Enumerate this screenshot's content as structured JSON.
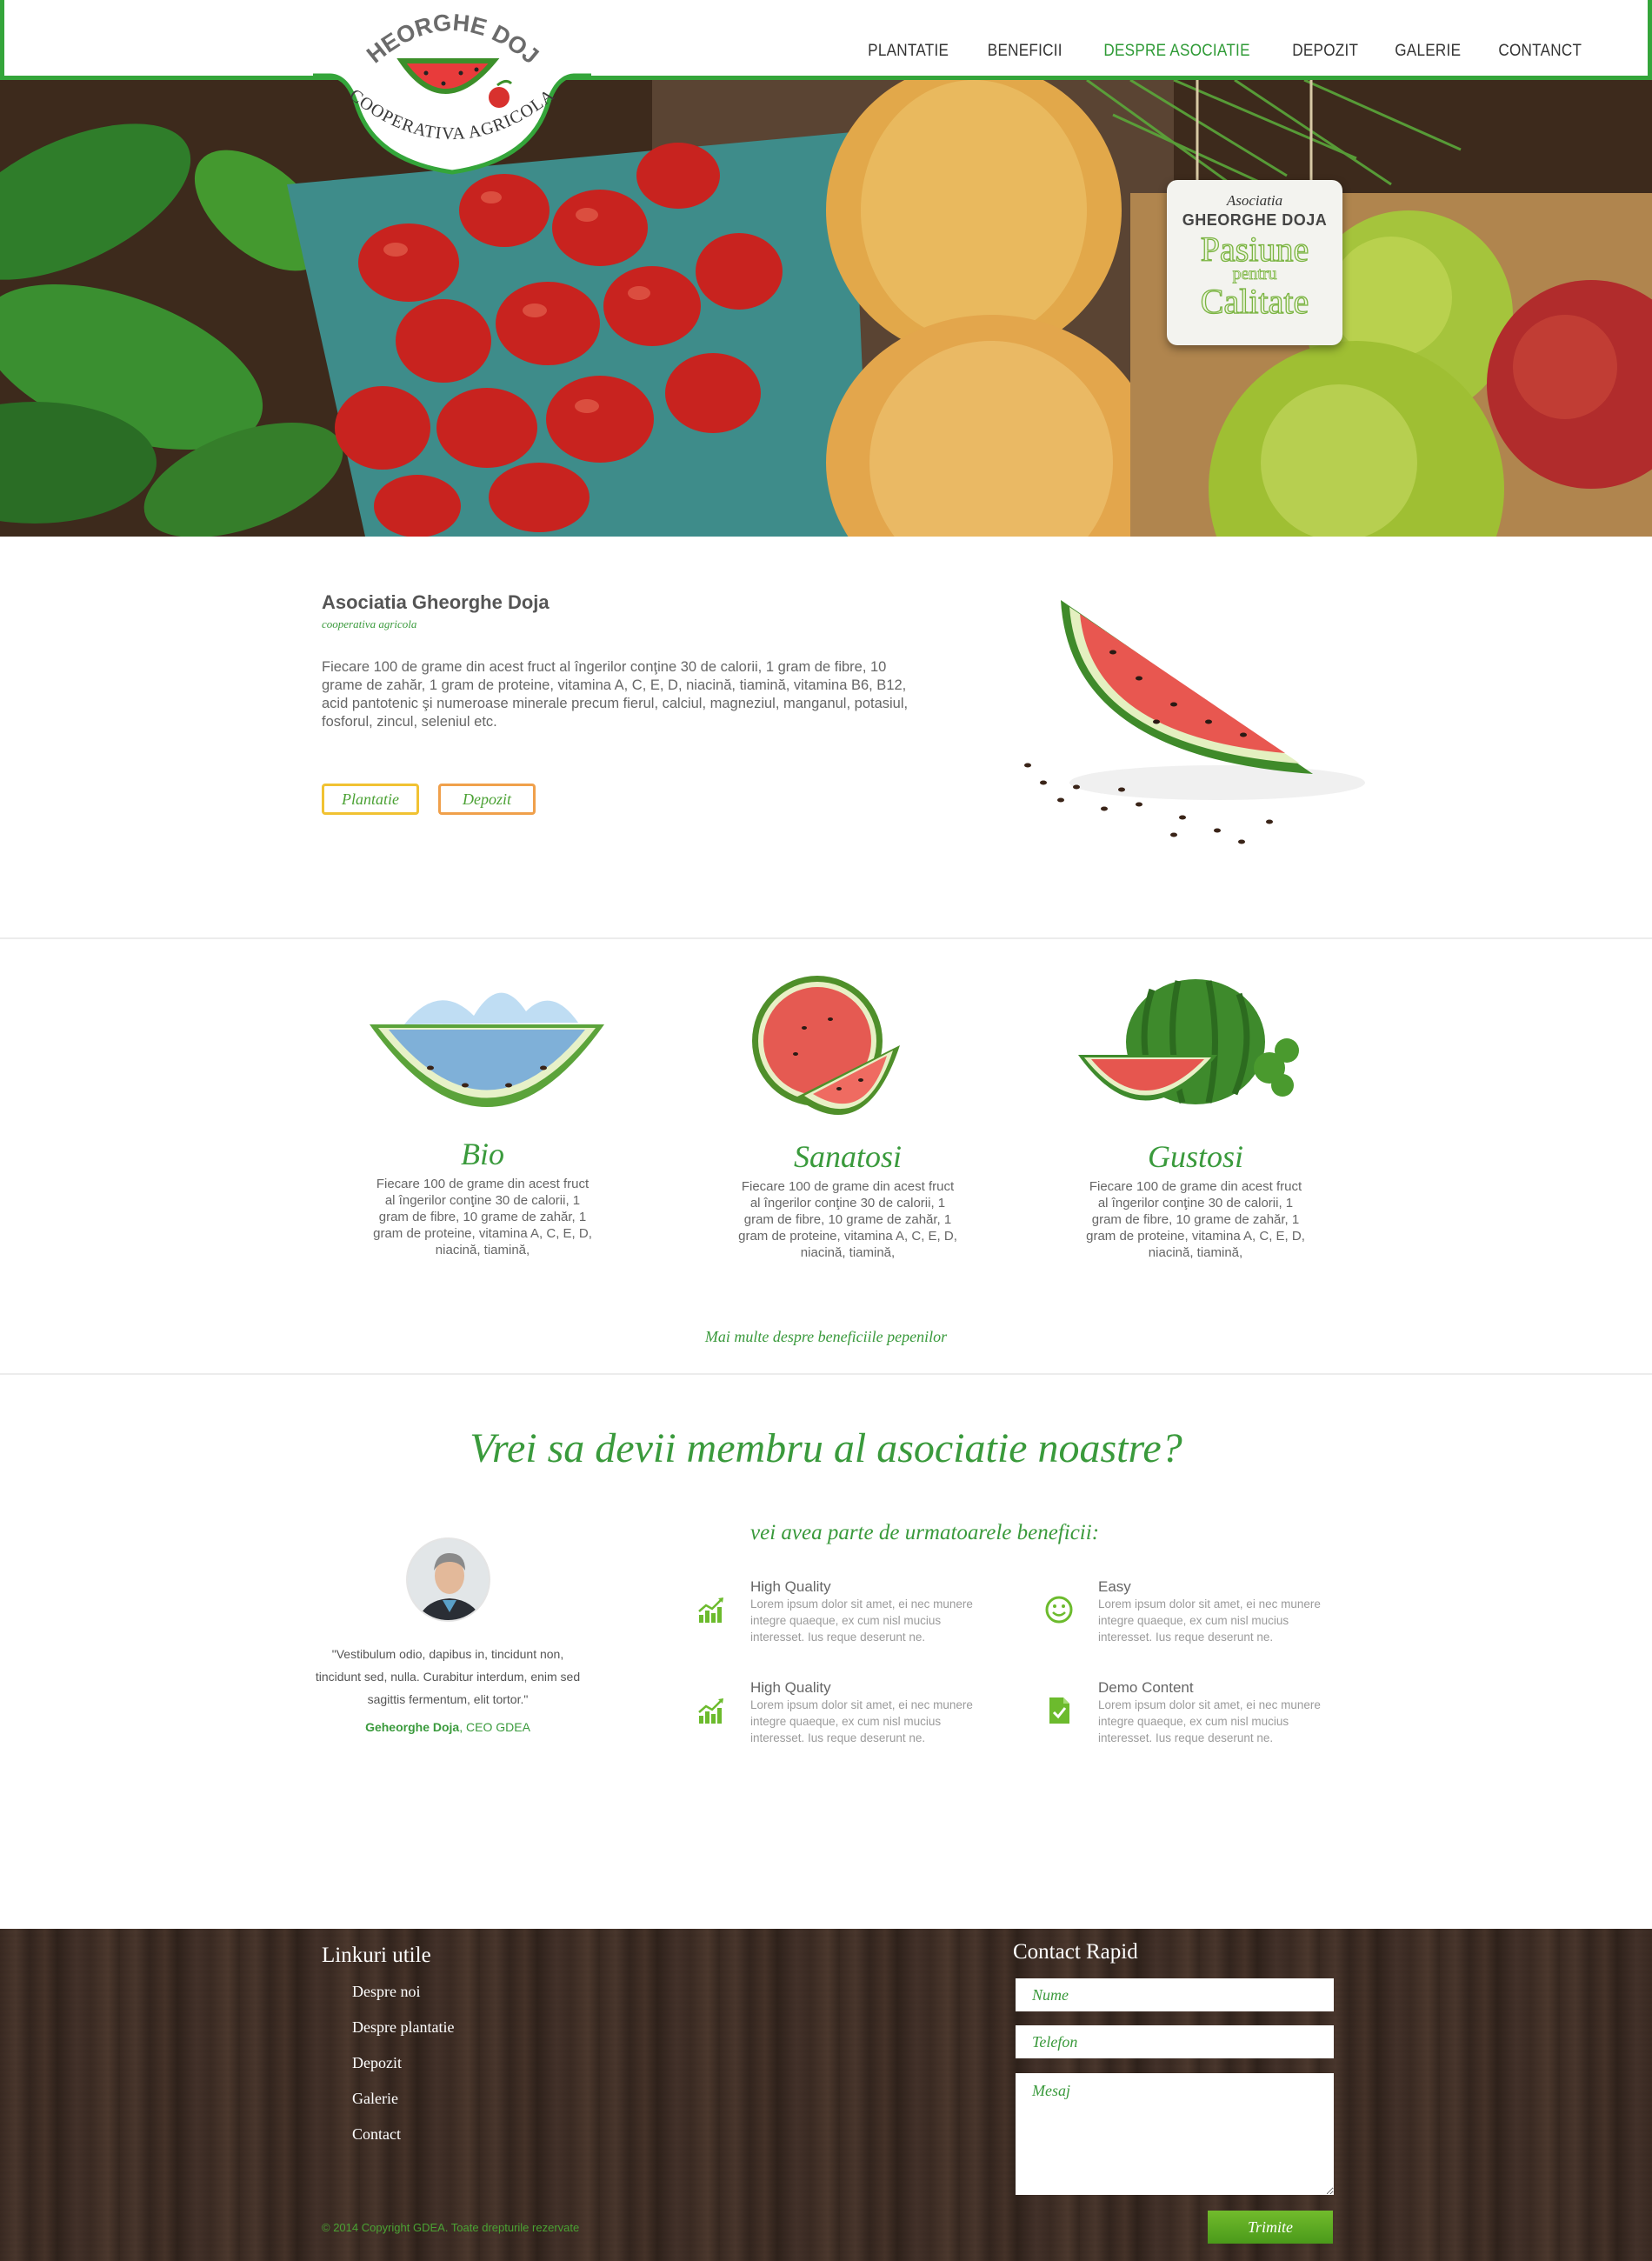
{
  "brand": {
    "logo_top": "GHEORGHE DOJA",
    "logo_bottom": "COOPERATIVA AGRICOLA"
  },
  "nav": {
    "items": [
      {
        "label": "PLANTATIE",
        "active": false
      },
      {
        "label": "BENEFICII",
        "active": false
      },
      {
        "label": "DESPRE ASOCIATIE",
        "active": true
      },
      {
        "label": "DEPOZIT",
        "active": false
      },
      {
        "label": "GALERIE",
        "active": false
      },
      {
        "label": "CONTANCT",
        "active": false
      }
    ]
  },
  "hero": {
    "tag_line1": "Asociatia",
    "tag_line2": "GHEORGHE DOJA",
    "tag_line3": "Pasiune",
    "tag_line4": "pentru",
    "tag_line5": "Calitate"
  },
  "intro": {
    "title": "Asociatia Gheorghe Doja",
    "subtitle": "cooperativa agricola",
    "text": "Fiecare 100 de grame din acest fruct al îngerilor conţine 30 de calorii, 1 gram de fibre, 10 grame de zahăr, 1 gram de proteine, vitamina A, C, E, D, niacină, tiamină, vitamina B6, B12, acid pantotenic şi numeroase minerale precum fierul, calciul, magneziul, manganul, potasiul, fosforul, zincul, seleniul etc.",
    "btn_plantatie": "Plantatie",
    "btn_depozit": "Depozit"
  },
  "benefits": {
    "items": [
      {
        "title": "Bio",
        "text": "Fiecare 100 de grame din acest fruct al îngerilor conţine 30 de calorii, 1 gram de fibre, 10 grame de zahăr, 1 gram de proteine, vitamina A, C, E, D, niacină, tiamină,"
      },
      {
        "title": "Sanatosi",
        "text": "Fiecare 100 de grame din acest fruct al îngerilor conţine 30 de calorii, 1 gram de fibre, 10 grame de zahăr, 1 gram de proteine, vitamina A, C, E, D, niacină, tiamină,"
      },
      {
        "title": "Gustosi",
        "text": "Fiecare 100 de grame din acest fruct al îngerilor conţine 30 de calorii, 1 gram de fibre, 10 grame de zahăr, 1 gram de proteine, vitamina A, C, E, D, niacină, tiamină,"
      }
    ],
    "more_link": "Mai multe despre beneficiile pepenilor"
  },
  "member": {
    "title": "Vrei sa devii membru al asociatie noastre?",
    "subtitle": "vei avea parte de urmatoarele beneficii:",
    "quote": "\"Vestibulum odio, dapibus in, tincidunt non, tincidunt sed, nulla. Curabitur interdum, enim sed sagittis fermentum, elit tortor.\"",
    "author_name": "Geheorghe Doja",
    "author_role": ", CEO GDEA",
    "features": [
      {
        "title": "High Quality",
        "text": "Lorem ipsum dolor sit amet, ei nec munere integre quaeque, ex cum nisl mucius interesset. Ius reque deserunt ne.",
        "icon": "chart-icon"
      },
      {
        "title": "Easy",
        "text": "Lorem ipsum dolor sit amet, ei nec munere integre quaeque, ex cum nisl mucius interesset. Ius reque deserunt ne.",
        "icon": "smiley-icon"
      },
      {
        "title": "High Quality",
        "text": "Lorem ipsum dolor sit amet, ei nec munere integre quaeque, ex cum nisl mucius interesset. Ius reque deserunt ne.",
        "icon": "chart-icon"
      },
      {
        "title": "Demo Content",
        "text": "Lorem ipsum dolor sit amet, ei nec munere integre quaeque, ex cum nisl mucius interesset. Ius reque deserunt ne.",
        "icon": "document-check-icon"
      }
    ]
  },
  "footer": {
    "links_title": "Linkuri utile",
    "links": [
      "Despre noi",
      "Despre plantatie",
      "Depozit",
      "Galerie",
      "Contact"
    ],
    "contact_title": "Contact Rapid",
    "name_placeholder": "Nume",
    "phone_placeholder": "Telefon",
    "message_placeholder": "Mesaj",
    "submit": "Trimite",
    "copyright": "© 2014 Copyright GDEA. Toate drepturile rezervate"
  },
  "colors": {
    "accent_green": "#34a53a",
    "button_yellow": "#f1c232",
    "button_orange": "#f0a04b",
    "wood_dark": "#3a2a22"
  }
}
